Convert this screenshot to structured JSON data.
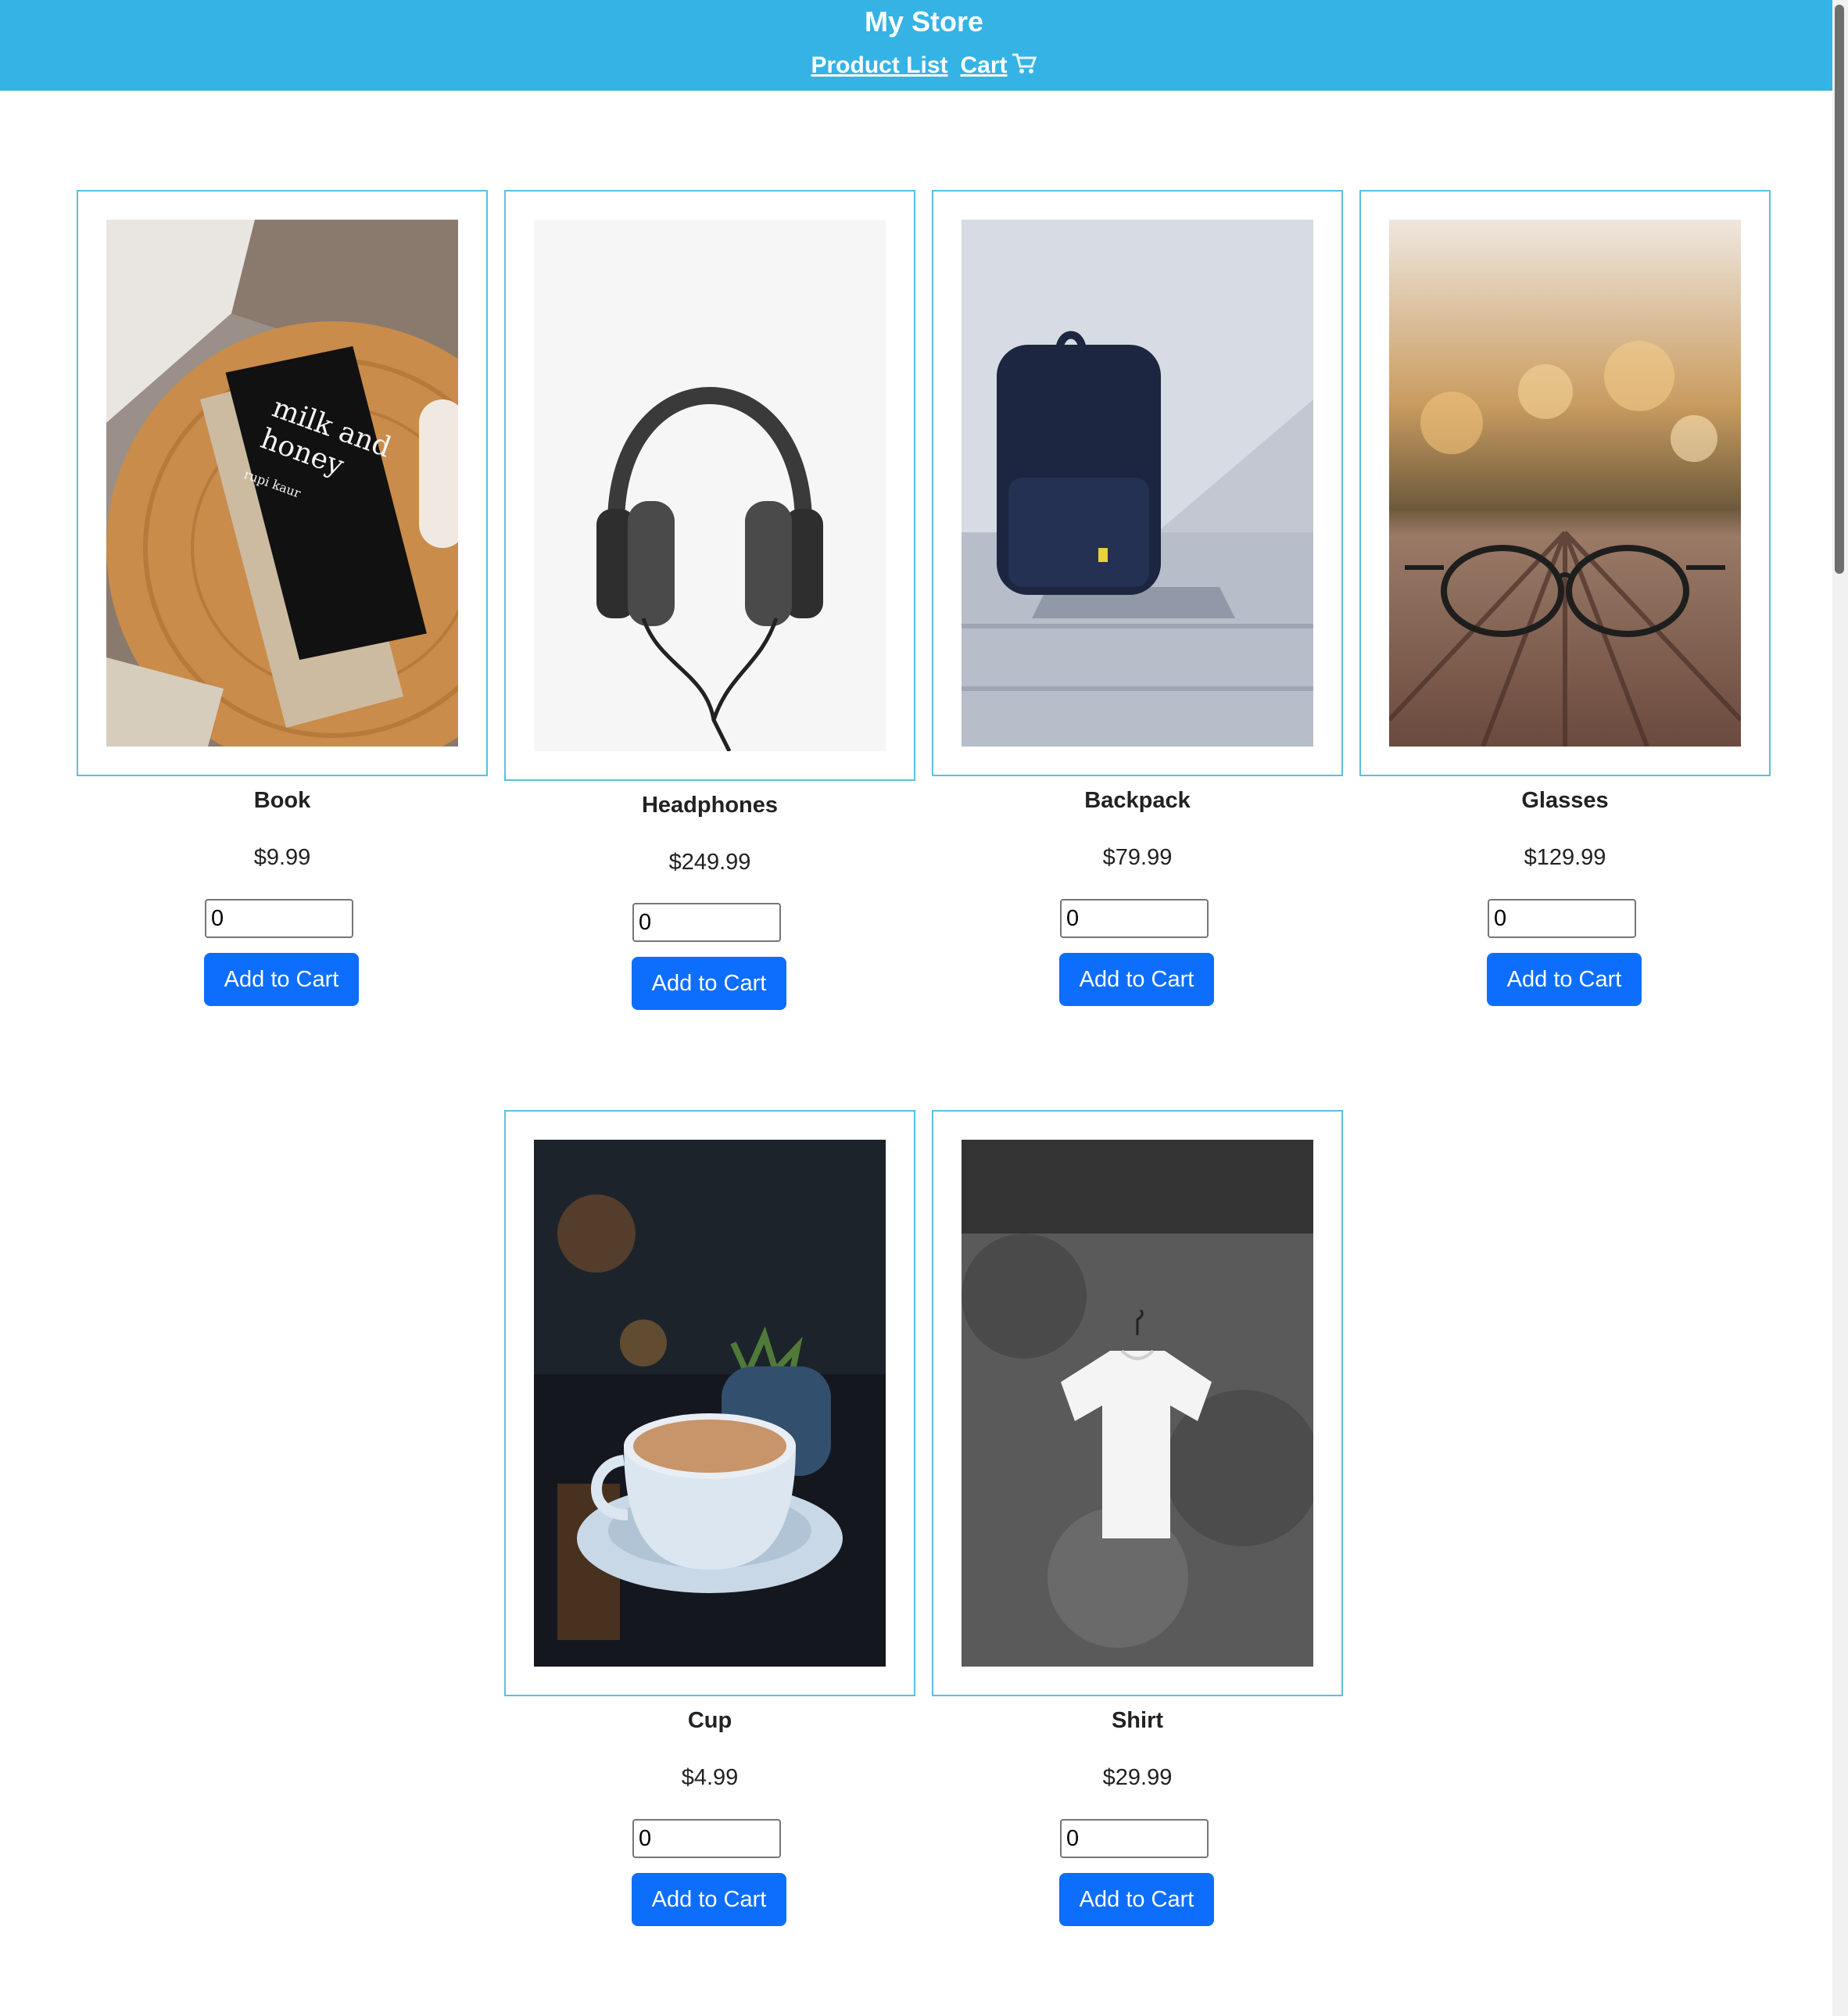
{
  "header": {
    "title": "My Store",
    "nav": {
      "product_list": "Product List",
      "cart": "Cart"
    },
    "background": "#34b3e4"
  },
  "accent_colors": {
    "button": "#0d6efd",
    "card_border": "#5bc0de"
  },
  "products": [
    {
      "name": "Book",
      "price": "$9.99",
      "quantity": "0",
      "button": "Add to Cart",
      "image": "book-photo"
    },
    {
      "name": "Headphones",
      "price": "$249.99",
      "quantity": "0",
      "button": "Add to Cart",
      "image": "headphones-photo"
    },
    {
      "name": "Backpack",
      "price": "$79.99",
      "quantity": "0",
      "button": "Add to Cart",
      "image": "backpack-photo"
    },
    {
      "name": "Glasses",
      "price": "$129.99",
      "quantity": "0",
      "button": "Add to Cart",
      "image": "glasses-photo"
    },
    {
      "name": "Cup",
      "price": "$4.99",
      "quantity": "0",
      "button": "Add to Cart",
      "image": "cup-photo"
    },
    {
      "name": "Shirt",
      "price": "$29.99",
      "quantity": "0",
      "button": "Add to Cart",
      "image": "shirt-photo"
    }
  ]
}
